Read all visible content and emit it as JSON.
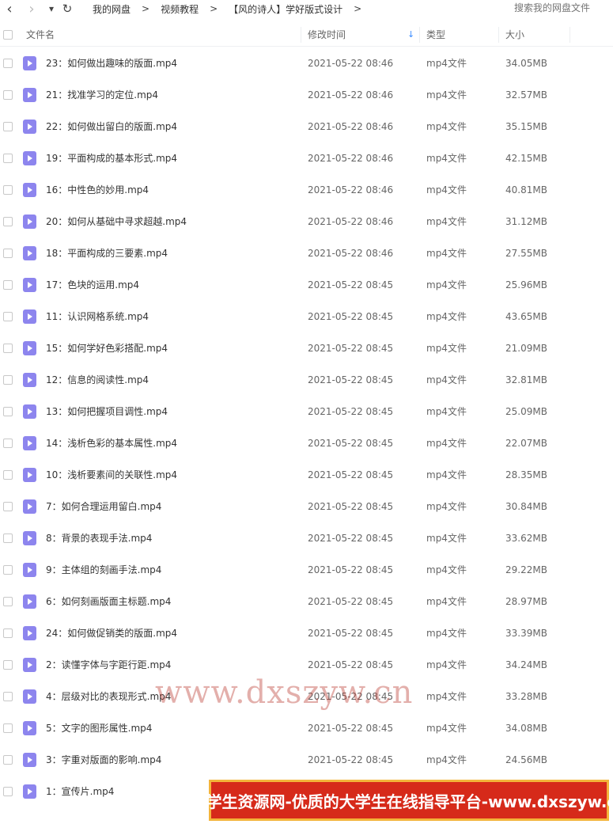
{
  "toolbar": {
    "back_glyph": "‹",
    "forward_glyph": "›",
    "dropdown_glyph": "▾",
    "refresh_glyph": "↻"
  },
  "breadcrumb": {
    "items": [
      "我的网盘",
      "视频教程",
      "【风的诗人】学好版式设计"
    ],
    "separator": ">"
  },
  "search": {
    "placeholder": "搜索我的网盘文件"
  },
  "columns": {
    "name": "文件名",
    "modified": "修改时间",
    "type": "类型",
    "size": "大小",
    "sort_glyph": "↓"
  },
  "files": [
    {
      "name": "23：如何做出趣味的版面.mp4",
      "time": "2021-05-22 08:46",
      "type": "mp4文件",
      "size": "34.05MB"
    },
    {
      "name": "21：找准学习的定位.mp4",
      "time": "2021-05-22 08:46",
      "type": "mp4文件",
      "size": "32.57MB"
    },
    {
      "name": "22：如何做出留白的版面.mp4",
      "time": "2021-05-22 08:46",
      "type": "mp4文件",
      "size": "35.15MB"
    },
    {
      "name": "19：平面构成的基本形式.mp4",
      "time": "2021-05-22 08:46",
      "type": "mp4文件",
      "size": "42.15MB"
    },
    {
      "name": "16：中性色的妙用.mp4",
      "time": "2021-05-22 08:46",
      "type": "mp4文件",
      "size": "40.81MB"
    },
    {
      "name": "20：如何从基础中寻求超越.mp4",
      "time": "2021-05-22 08:46",
      "type": "mp4文件",
      "size": "31.12MB"
    },
    {
      "name": "18：平面构成的三要素.mp4",
      "time": "2021-05-22 08:46",
      "type": "mp4文件",
      "size": "27.55MB"
    },
    {
      "name": "17：色块的运用.mp4",
      "time": "2021-05-22 08:45",
      "type": "mp4文件",
      "size": "25.96MB"
    },
    {
      "name": "11：认识网格系统.mp4",
      "time": "2021-05-22 08:45",
      "type": "mp4文件",
      "size": "43.65MB"
    },
    {
      "name": "15：如何学好色彩搭配.mp4",
      "time": "2021-05-22 08:45",
      "type": "mp4文件",
      "size": "21.09MB"
    },
    {
      "name": "12：信息的阅读性.mp4",
      "time": "2021-05-22 08:45",
      "type": "mp4文件",
      "size": "32.81MB"
    },
    {
      "name": "13：如何把握项目调性.mp4",
      "time": "2021-05-22 08:45",
      "type": "mp4文件",
      "size": "25.09MB"
    },
    {
      "name": "14：浅析色彩的基本属性.mp4",
      "time": "2021-05-22 08:45",
      "type": "mp4文件",
      "size": "22.07MB"
    },
    {
      "name": "10：浅析要素间的关联性.mp4",
      "time": "2021-05-22 08:45",
      "type": "mp4文件",
      "size": "28.35MB"
    },
    {
      "name": "7：如何合理运用留白.mp4",
      "time": "2021-05-22 08:45",
      "type": "mp4文件",
      "size": "30.84MB"
    },
    {
      "name": "8：背景的表现手法.mp4",
      "time": "2021-05-22 08:45",
      "type": "mp4文件",
      "size": "33.62MB"
    },
    {
      "name": "9：主体组的刻画手法.mp4",
      "time": "2021-05-22 08:45",
      "type": "mp4文件",
      "size": "29.22MB"
    },
    {
      "name": "6：如何刻画版面主标题.mp4",
      "time": "2021-05-22 08:45",
      "type": "mp4文件",
      "size": "28.97MB"
    },
    {
      "name": "24：如何做促销类的版面.mp4",
      "time": "2021-05-22 08:45",
      "type": "mp4文件",
      "size": "33.39MB"
    },
    {
      "name": "2：读懂字体与字距行距.mp4",
      "time": "2021-05-22 08:45",
      "type": "mp4文件",
      "size": "34.24MB"
    },
    {
      "name": "4：层级对比的表现形式.mp4",
      "time": "2021-05-22 08:45",
      "type": "mp4文件",
      "size": "33.28MB"
    },
    {
      "name": "5：文字的图形属性.mp4",
      "time": "2021-05-22 08:45",
      "type": "mp4文件",
      "size": "34.08MB"
    },
    {
      "name": "3：字重对版面的影响.mp4",
      "time": "2021-05-22 08:45",
      "type": "mp4文件",
      "size": "24.56MB"
    },
    {
      "name": "1：宣传片.mp4",
      "time": "",
      "type": "",
      "size": ""
    }
  ],
  "watermark": "www.dxszyw.cn",
  "banner": "大学生资源网-优质的大学生在线指导平台-www.dxszyw.cn",
  "colors": {
    "video_icon": "#8d85ee",
    "banner_bg": "#d62a1a",
    "banner_border": "#f3b43a",
    "sort_accent": "#3b8cff"
  }
}
